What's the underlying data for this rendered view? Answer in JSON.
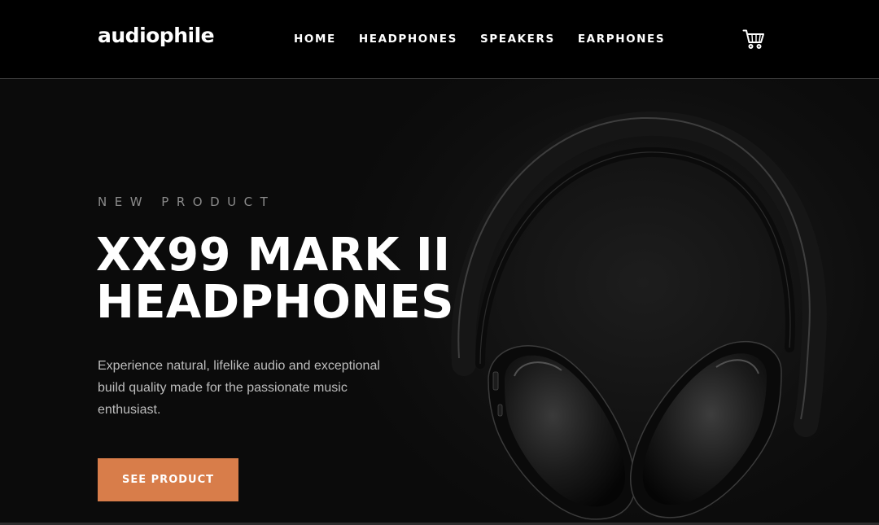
{
  "header": {
    "logo": "audiophile",
    "nav": [
      {
        "label": "HOME"
      },
      {
        "label": "HEADPHONES"
      },
      {
        "label": "SPEAKERS"
      },
      {
        "label": "EARPHONES"
      }
    ],
    "cart_icon": "cart-icon"
  },
  "hero": {
    "overline": "NEW PRODUCT",
    "title_line1": "XX99 MARK II",
    "title_line2": "HEADPHONES",
    "description": "Experience natural, lifelike audio and exceptional build quality made for the passionate music enthusiast.",
    "cta_label": "SEE PRODUCT",
    "image": "headphones-image"
  },
  "colors": {
    "accent": "#D87D4A",
    "header_bg": "#000000",
    "hero_bg": "#0E0E0E",
    "text": "#FFFFFF",
    "muted_text": "#BDBDBD"
  }
}
